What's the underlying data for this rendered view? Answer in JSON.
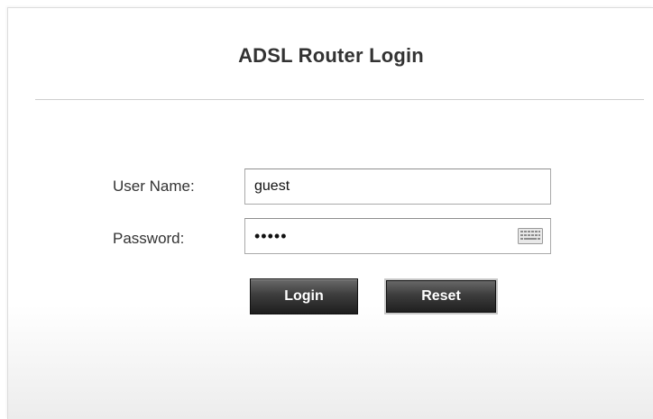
{
  "page": {
    "title": "ADSL Router Login"
  },
  "form": {
    "username": {
      "label": "User Name:",
      "value": "guest"
    },
    "password": {
      "label": "Password:",
      "value": "guest",
      "keyboard_icon": "keyboard-icon"
    },
    "buttons": {
      "login_label": "Login",
      "reset_label": "Reset"
    }
  }
}
